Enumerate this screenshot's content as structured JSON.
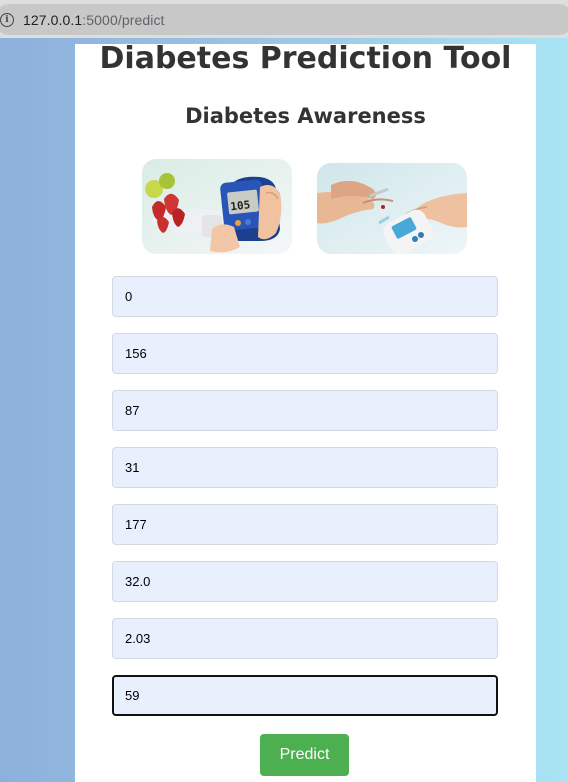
{
  "browser": {
    "url_host": "127.0.0.1",
    "url_path": ":5000/predict"
  },
  "page": {
    "title": "Diabetes Prediction Tool",
    "section_title": "Diabetes Awareness"
  },
  "images": [
    {
      "name": "glucose-meter-photo",
      "reading": "105"
    },
    {
      "name": "finger-prick-test-photo"
    }
  ],
  "form": {
    "fields": [
      {
        "value": "0"
      },
      {
        "value": "156"
      },
      {
        "value": "87"
      },
      {
        "value": "31"
      },
      {
        "value": "177"
      },
      {
        "value": "32.0"
      },
      {
        "value": "2.03"
      },
      {
        "value": "59"
      }
    ],
    "submit_label": "Predict"
  },
  "colors": {
    "button": "#4caf50",
    "field_bg": "#e8f0fe",
    "title": "#333333"
  }
}
